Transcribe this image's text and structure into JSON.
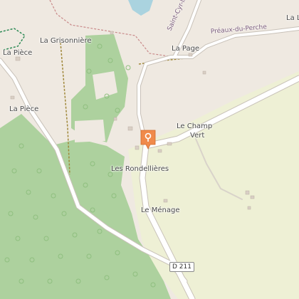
{
  "map": {
    "labels": {
      "la_grisonniere": "La Grisonnière",
      "la_piece_top": "La Pièce",
      "la_piece": "La Pièce",
      "la_page": "La Page",
      "le_champ_vert_1": "Le Champ",
      "le_champ_vert_2": "Vert",
      "les_rondellieres": "Les Rondellières",
      "le_menage": "Le Ménage",
      "la_l": "La L"
    },
    "roads": {
      "saint_cyr": "Saint-Cyr-la",
      "preaux": "Préaux-du-Perche",
      "d211": "D 211"
    },
    "colors": {
      "background": "#efe9e1",
      "forest": "#add19e",
      "meadow": "#eef0d5",
      "water": "#aad3df",
      "road": "#ffffff",
      "road_casing": "#c8c1b8",
      "marker": "#f08a4b"
    },
    "marker_icon": "location-pin-icon"
  }
}
